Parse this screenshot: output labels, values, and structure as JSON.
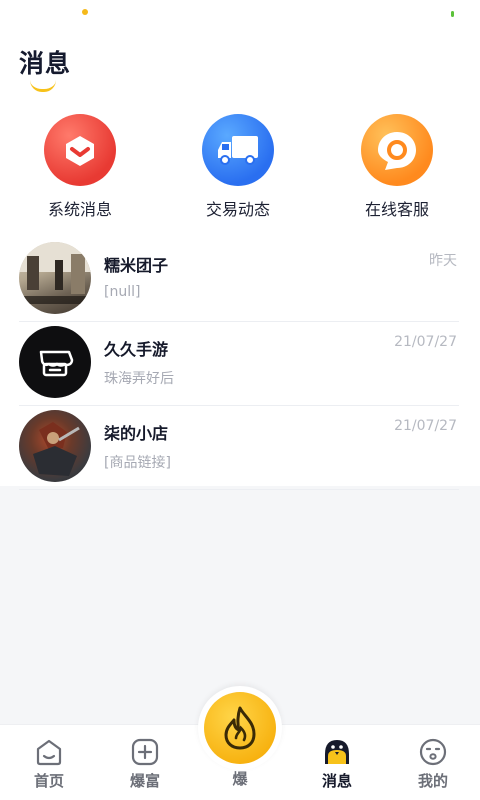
{
  "colors": {
    "accent": "#F7B10F",
    "red": "#E83A33",
    "blue": "#2A6FF0",
    "orange": "#FF8A1E"
  },
  "header": {
    "title": "消息"
  },
  "quick_actions": [
    {
      "label": "系统消息",
      "icon": "gift-box-icon"
    },
    {
      "label": "交易动态",
      "icon": "truck-icon"
    },
    {
      "label": "在线客服",
      "icon": "chat-bubble-icon"
    }
  ],
  "messages": [
    {
      "name": "糯米团子",
      "preview": "[null]",
      "time": "昨天"
    },
    {
      "name": "久久手游",
      "preview": "珠海弄好后",
      "time": "21/07/27"
    },
    {
      "name": "柒的小店",
      "preview": "[商品链接]",
      "time": "21/07/27"
    }
  ],
  "tabbar": {
    "items": [
      {
        "label": "首页",
        "icon": "home-face-icon"
      },
      {
        "label": "爆富",
        "icon": "plus-square-icon"
      },
      {
        "label": "爆",
        "icon": "flame-icon"
      },
      {
        "label": "消息",
        "icon": "chick-icon"
      },
      {
        "label": "我的",
        "icon": "profile-face-icon"
      }
    ],
    "active": "消息"
  }
}
